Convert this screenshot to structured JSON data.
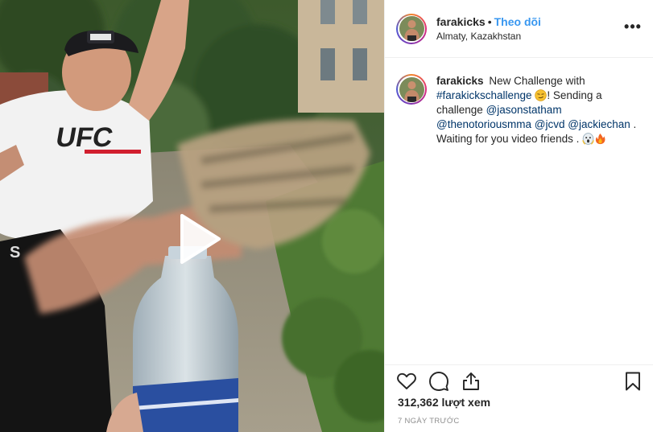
{
  "header": {
    "username": "farakicks",
    "separator": "•",
    "follow_label": "Theo dõi",
    "location": "Almaty, Kazakhstan",
    "more_label": "•••"
  },
  "caption": {
    "username": "farakicks",
    "text_1": "New Challenge with",
    "hashtag": "#farakickschallenge",
    "text_2": "! Sending a challenge",
    "mention_1": "@jasonstatham",
    "mention_2": "@thenotoriousmma",
    "mention_3": "@jcvd",
    "mention_4": "@jackiechan",
    "text_3": ". Waiting for you video friends ."
  },
  "stats": {
    "views": "312,362 lượt xem",
    "timestamp": "7 NGÀY TRƯỚC"
  },
  "icons": {
    "like": "heart-icon",
    "comment": "comment-icon",
    "share": "share-icon",
    "save": "bookmark-icon",
    "play": "play-icon"
  },
  "colors": {
    "accent": "#3897f0",
    "link": "#003569",
    "muted": "#8e8e8e",
    "text": "#262626"
  }
}
